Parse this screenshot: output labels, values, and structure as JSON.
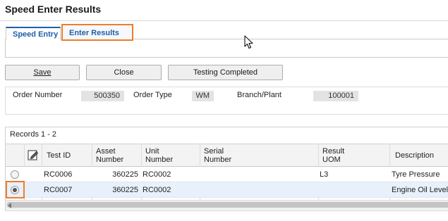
{
  "page_title": "Speed Enter Results",
  "tabs": [
    {
      "label": "Speed Entry"
    },
    {
      "label": "Enter Results"
    }
  ],
  "toolbar": {
    "save_label": "Save",
    "close_label": "Close",
    "testing_completed_label": "Testing Completed"
  },
  "header": {
    "order_number_label": "Order Number",
    "order_number_value": "500350",
    "order_type_label": "Order Type",
    "order_type_value": "WM",
    "branch_plant_label": "Branch/Plant",
    "branch_plant_value": "100001"
  },
  "grid": {
    "records_label": "Records 1 - 2",
    "columns": {
      "test_id": "Test ID",
      "asset_number_1": "Asset",
      "asset_number_2": "Number",
      "unit_number_1": "Unit",
      "unit_number_2": "Number",
      "serial_number_1": "Serial",
      "serial_number_2": "Number",
      "result_uom_1": "Result",
      "result_uom_2": "UOM",
      "description": "Description"
    },
    "rows": [
      {
        "selected": false,
        "test_id": "RC0006",
        "asset_number": "360225",
        "unit_number": "RC0002",
        "serial_number": "",
        "result_uom": "L3",
        "description": "Tyre Pressure"
      },
      {
        "selected": true,
        "test_id": "RC0007",
        "asset_number": "360225",
        "unit_number": "RC0002",
        "serial_number": "",
        "result_uom": "",
        "description": "Engine Oil Level"
      }
    ]
  },
  "colors": {
    "accent_highlight": "#f07c2a",
    "tab_text": "#1f5fa8",
    "selected_row": "#e8f1fb"
  },
  "icons": {
    "edit_column_icon": "pencil-edit-icon",
    "cursor": "mouse-pointer-icon"
  }
}
